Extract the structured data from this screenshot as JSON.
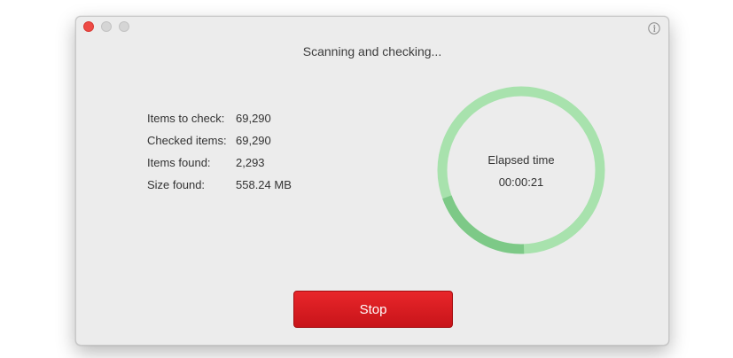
{
  "window": {
    "title": "Scanning and checking...",
    "controls": [
      "close-icon",
      "minimize-icon",
      "zoom-icon"
    ],
    "info_icon": "info-icon"
  },
  "stats": [
    {
      "label": "Items to check:",
      "value": "69,290"
    },
    {
      "label": "Checked items:",
      "value": "69,290"
    },
    {
      "label": "Items found:",
      "value": "2,293"
    },
    {
      "label": "Size found:",
      "value": "558.24 MB"
    }
  ],
  "elapsed": {
    "label": "Elapsed time",
    "value": "00:00:21",
    "progress_fraction": 0.2
  },
  "stop_button": {
    "label": "Stop"
  },
  "colors": {
    "ring_track": "#a8e2ad",
    "ring_progress": "#7dc987",
    "stop_red": "#d81b20",
    "close_red": "#ee4b45"
  }
}
